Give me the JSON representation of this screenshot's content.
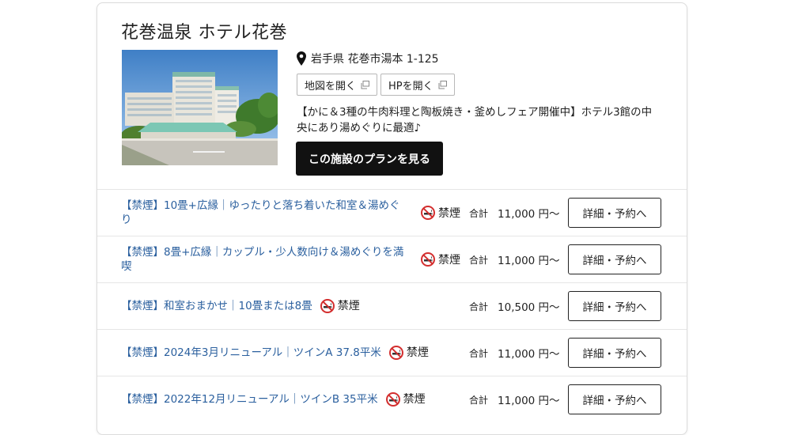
{
  "hotel": {
    "name": "花巻温泉 ホテル花巻",
    "address": "岩手県 花巻市湯本 1-125",
    "map_button": "地図を開く",
    "hp_button": "HPを開く",
    "description": "【かに＆3種の牛肉料理と陶板焼き・釜めしフェア開催中】ホテル3館の中央にあり湯めぐりに最適♪",
    "plan_button": "この施設のプランを見る"
  },
  "rooms": [
    {
      "name": "【禁煙】10畳+広縁｜ゆったりと落ち着いた和室＆湯めぐり",
      "smoking": "禁煙",
      "total_label": "合計",
      "price": "11,000 円〜",
      "button": "詳細・予約へ"
    },
    {
      "name": "【禁煙】8畳+広縁｜カップル・少人数向け＆湯めぐりを満喫",
      "smoking": "禁煙",
      "total_label": "合計",
      "price": "11,000 円〜",
      "button": "詳細・予約へ"
    },
    {
      "name": "【禁煙】和室おまかせ｜10畳または8畳",
      "smoking": "禁煙",
      "total_label": "合計",
      "price": "10,500 円〜",
      "button": "詳細・予約へ"
    },
    {
      "name": "【禁煙】2024年3月リニューアル｜ツインA 37.8平米",
      "smoking": "禁煙",
      "total_label": "合計",
      "price": "11,000 円〜",
      "button": "詳細・予約へ"
    },
    {
      "name": "【禁煙】2022年12月リニューアル｜ツインB 35平米",
      "smoking": "禁煙",
      "total_label": "合計",
      "price": "11,000 円〜",
      "button": "詳細・予約へ"
    }
  ],
  "icons": {
    "address": "map-pin-icon",
    "external": "external-window-icon",
    "smoking": "no-smoking-icon"
  },
  "colors": {
    "room_link": "#2a5f9e",
    "cta_background": "#111111",
    "no_smoking_red": "#d32f2f"
  }
}
